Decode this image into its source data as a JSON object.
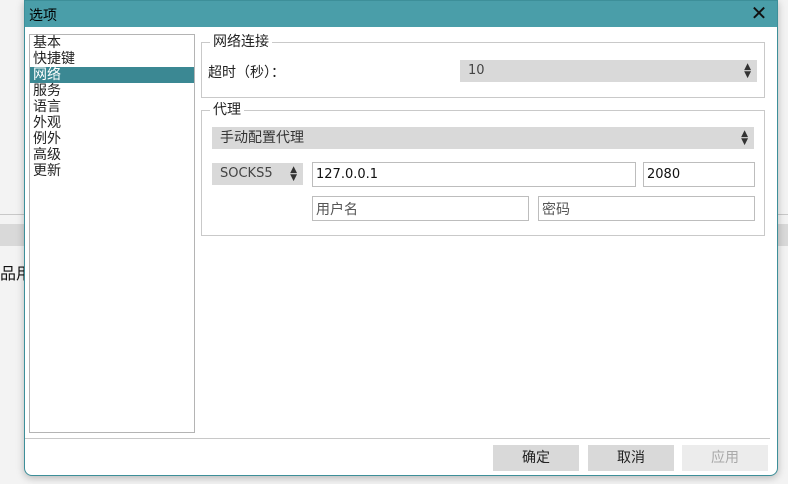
{
  "background": {
    "text": "品用"
  },
  "dialog": {
    "title": "选项",
    "close_label": "✕",
    "nav": [
      "基本",
      "快捷键",
      "网络",
      "服务",
      "语言",
      "外观",
      "例外",
      "高级",
      "更新"
    ],
    "active_nav_index": 2,
    "network": {
      "group_title": "网络连接",
      "timeout_label": "超时（秒）：",
      "timeout_value": "10"
    },
    "proxy": {
      "group_title": "代理",
      "mode": "手动配置代理",
      "protocol": "SOCKS5",
      "host": "127.0.0.1",
      "port": "2080",
      "username_placeholder": "用户名",
      "password_placeholder": "密码"
    },
    "buttons": {
      "ok": "确定",
      "cancel": "取消",
      "apply": "应用"
    }
  }
}
